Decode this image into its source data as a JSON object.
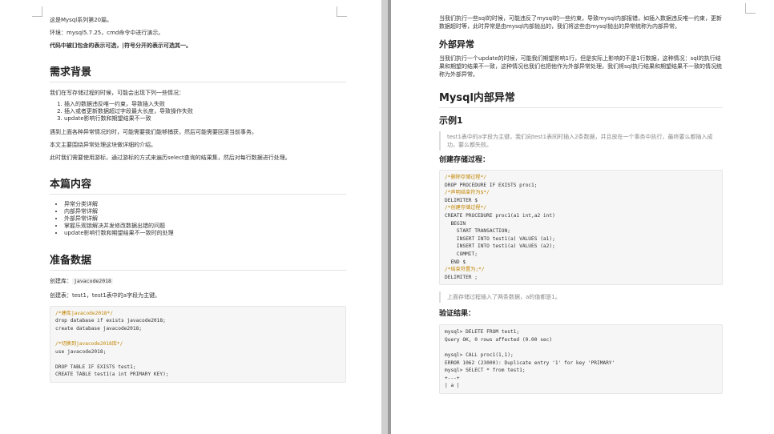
{
  "left": {
    "intro1": "这是Mysql系列第20篇。",
    "intro2": "环境：mysql5.7.25，cmd命令中进行演示。",
    "intro3": "代码中被[]包含的表示可选，|符号分开的表示可选其一。",
    "section1_title": "需求背景",
    "section1_p1": "我们在写存储过程的时候，可能会出现下列一些情况：",
    "section1_list": [
      "插入的数据违反唯一约束，导致插入失败",
      "插入或者更新数据超过字段最大长度，导致操作失败",
      "update影响行数和期望结果不一致"
    ],
    "section1_p2": "遇到上面各种异常情况的时，可能需要我们能够捕获，然后可能需要回滚当前事务。",
    "section1_p3": "本文主要围绕异常处理这块做详细的介绍。",
    "section1_p4": "此时我们需要使用游标，通过游标的方式来遍历select查询的结果集，然后对每行数据进行处理。",
    "section2_title": "本篇内容",
    "section2_list": [
      "异常分类详解",
      "内部异常详解",
      "外部异常详解",
      "掌握乐观锁解决并发修改数据出错的问题",
      "update影响行数和期望结果不一致时的处理"
    ],
    "section3_title": "准备数据",
    "create_db_label": "创建库：",
    "create_db_value": "javacode2018",
    "create_table_text": "创建表：test1，test1表中的a字段为主键。",
    "code1": [
      {
        "t": "comment",
        "s": "/*建库javacode2018*/"
      },
      {
        "t": "plain",
        "s": "drop database if exists javacode2018;"
      },
      {
        "t": "plain",
        "s": "create database javacode2018;"
      },
      {
        "t": "plain",
        "s": ""
      },
      {
        "t": "comment",
        "s": "/*切换到javacode2018库*/"
      },
      {
        "t": "plain",
        "s": "use javacode2018;"
      },
      {
        "t": "plain",
        "s": ""
      },
      {
        "t": "plain",
        "s": "DROP TABLE IF EXISTS test1;"
      },
      {
        "t": "plain",
        "s": "CREATE TABLE test1(a int PRIMARY KEY);"
      }
    ]
  },
  "right": {
    "top_para": "当我们执行一些sql的时候，可能违反了mysql的一些约束，导致mysql内部报错，如插入数据违反唯一约束，更新数据超时等，此时异常是由mysql内部抛出的，我们将这些由mysql抛出的异常统称为内部异常。",
    "ext_title": "外部异常",
    "ext_para": "当我们执行一个update的时候，可能我们期望影响1行，但是实际上影响的不是1行数据，这种情况：sql的执行结果和期望的结果不一致，这种情况也我们也把他作为外部异常处理，我们将sql执行结果和期望结果不一致的情况统称为外部异常。",
    "mysql_title": "Mysql内部异常",
    "example_title": "示例1",
    "example_quote": "test1表中的a字段为主键，我们向test1表同时插入2条数据，并且放在一个事务中执行，最终要么都插入成功，要么都失败。",
    "create_proc_title": "创建存储过程：",
    "code2": [
      {
        "t": "comment",
        "s": "/*删除存储过程*/"
      },
      {
        "t": "plain",
        "s": "DROP PROCEDURE IF EXISTS proc1;"
      },
      {
        "t": "comment",
        "s": "/*声明结束符为$*/"
      },
      {
        "t": "plain",
        "s": "DELIMITER $"
      },
      {
        "t": "comment",
        "s": "/*创建存储过程*/"
      },
      {
        "t": "plain",
        "s": "CREATE PROCEDURE proc1(a1 int,a2 int)"
      },
      {
        "t": "plain",
        "s": "  BEGIN"
      },
      {
        "t": "plain",
        "s": "    START TRANSACTION;"
      },
      {
        "t": "plain",
        "s": "    INSERT INTO test1(a) VALUES (a1);"
      },
      {
        "t": "plain",
        "s": "    INSERT INTO test1(a) VALUES (a2);"
      },
      {
        "t": "plain",
        "s": "    COMMIT;"
      },
      {
        "t": "plain",
        "s": "  END $"
      },
      {
        "t": "comment",
        "s": "/*结束符置为;*/"
      },
      {
        "t": "plain",
        "s": "DELIMITER ;"
      }
    ],
    "note_quote": "上面存储过程插入了两条数据，a的值都是1。",
    "verify_title": "验证结果：",
    "code3": [
      {
        "t": "plain",
        "s": "mysql> DELETE FROM test1;"
      },
      {
        "t": "plain",
        "s": "Query OK, 0 rows affected (0.00 sec)"
      },
      {
        "t": "plain",
        "s": ""
      },
      {
        "t": "plain",
        "s": "mysql> CALL proc1(1,1);"
      },
      {
        "t": "plain",
        "s": "ERROR 1062 (23000): Duplicate entry '1' for key 'PRIMARY'"
      },
      {
        "t": "plain",
        "s": "mysql> SELECT * from test1;"
      },
      {
        "t": "plain",
        "s": "+---+"
      },
      {
        "t": "plain",
        "s": "| a |"
      }
    ]
  }
}
